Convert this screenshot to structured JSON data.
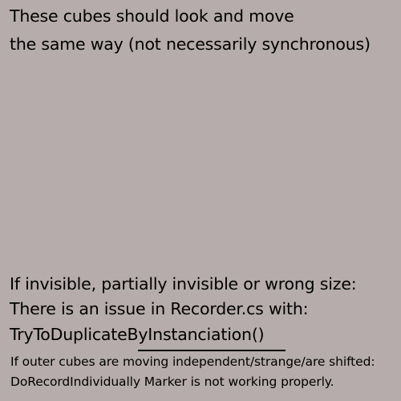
{
  "top_text": {
    "line1": "These cubes should look and move",
    "line2": "the same way (not necessarily synchronous)"
  },
  "issue_text": {
    "line1": "If invisible, partially invisible or wrong size:",
    "line2": "There is an issue in Recorder.cs with:",
    "line3": "TryToDuplicateByInstanciation()"
  },
  "marker_text": {
    "line1": "If outer cubes are moving independent/strange/are shifted:",
    "line2": "DoRecordIndividually Marker is not working properly."
  },
  "colors": {
    "background": "#b5acab",
    "text": "#000000"
  }
}
